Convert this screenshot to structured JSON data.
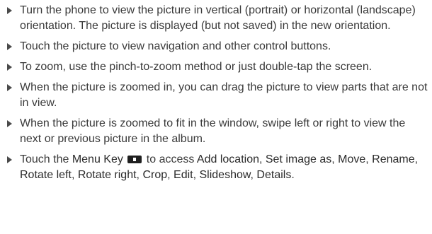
{
  "items": [
    {
      "text": "Turn the phone to view the picture in vertical (portrait) or horizontal (landscape) orientation. The picture is displayed (but not saved) in the new orientation."
    },
    {
      "text": "Touch the picture to view navigation and other control buttons."
    },
    {
      "text": "To zoom, use the pinch-to-zoom method or just double-tap the screen."
    },
    {
      "text": "When the picture is zoomed in, you can drag the picture to view parts that are not in view."
    },
    {
      "text": "When the picture is zoomed to fit in the window, swipe left or right to view the next or previous picture in the album."
    },
    {
      "prefix": "Touch the ",
      "menu_key": "Menu Key",
      "mid": " to access ",
      "options": [
        "Add location",
        "Set image as",
        "Move",
        "Rename",
        "Rotate left",
        "Rotate right",
        "Crop",
        "Edit",
        "Slideshow",
        "Details"
      ],
      "separator": ", ",
      "end": "."
    }
  ],
  "icons": {
    "bullet": "triangle-right-icon",
    "menu_key": "menu-key-icon"
  }
}
